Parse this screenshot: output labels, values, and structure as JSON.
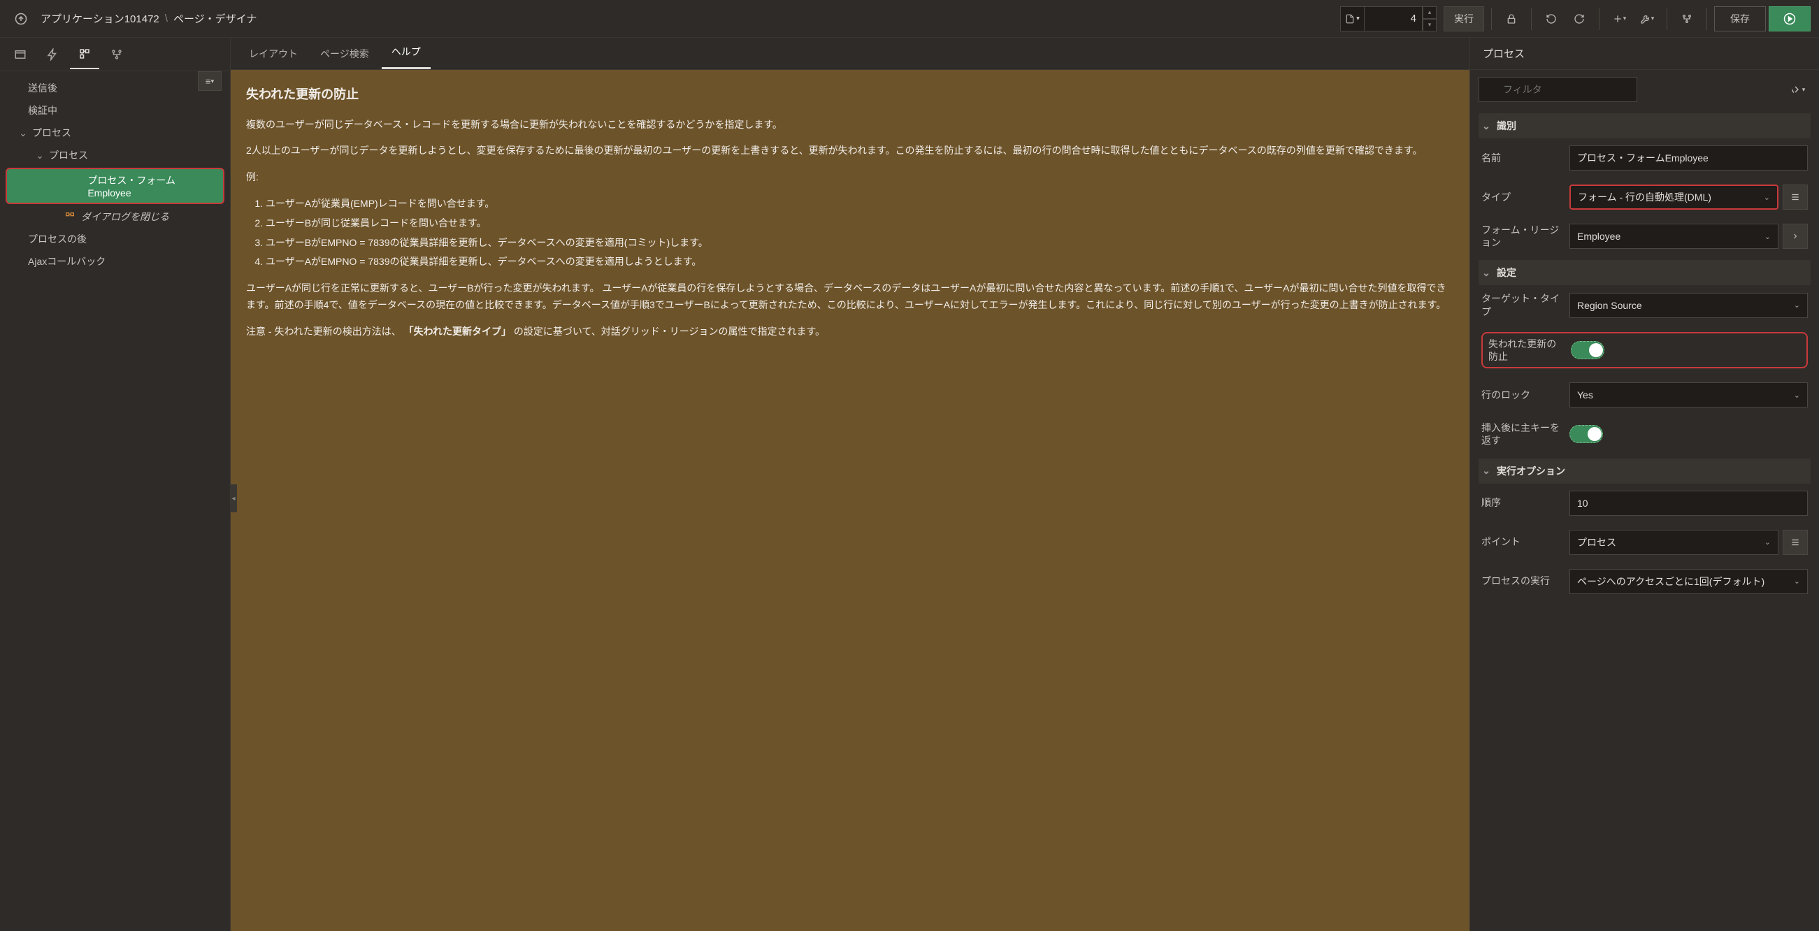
{
  "breadcrumb": {
    "app": "アプリケーション101472",
    "page": "ページ・デザイナ"
  },
  "topbar": {
    "page_number": "4",
    "go_label": "実行",
    "save_label": "保存"
  },
  "left_tree": {
    "items": {
      "after_submit": "送信後",
      "validating": "検証中",
      "processes": "プロセス",
      "processes_sub": "プロセス",
      "selected": "プロセス・フォームEmployee",
      "close_dialog": "ダイアログを閉じる",
      "after_processes": "プロセスの後",
      "ajax_callback": "Ajaxコールバック"
    }
  },
  "center": {
    "tabs": {
      "layout": "レイアウト",
      "page_search": "ページ検索",
      "help": "ヘルプ"
    },
    "help": {
      "title": "失われた更新の防止",
      "p1": "複数のユーザーが同じデータベース・レコードを更新する場合に更新が失われないことを確認するかどうかを指定します。",
      "p2": "2人以上のユーザーが同じデータを更新しようとし、変更を保存するために最後の更新が最初のユーザーの更新を上書きすると、更新が失われます。この発生を防止するには、最初の行の問合せ時に取得した値とともにデータベースの既存の列値を更新で確認できます。",
      "example_label": "例:",
      "ol": [
        "ユーザーAが従業員(EMP)レコードを問い合せます。",
        "ユーザーBが同じ従業員レコードを問い合せます。",
        "ユーザーBがEMPNO = 7839の従業員詳細を更新し、データベースへの変更を適用(コミット)します。",
        "ユーザーAがEMPNO = 7839の従業員詳細を更新し、データベースへの変更を適用しようとします。"
      ],
      "p3": "ユーザーAが同じ行を正常に更新すると、ユーザーBが行った変更が失われます。 ユーザーAが従業員の行を保存しようとする場合、データベースのデータはユーザーAが最初に問い合せた内容と異なっています。前述の手順1で、ユーザーAが最初に問い合せた列値を取得できます。前述の手順4で、値をデータベースの現在の値と比較できます。データベース値が手順3でユーザーBによって更新されたため、この比較により、ユーザーAに対してエラーが発生します。これにより、同じ行に対して別のユーザーが行った変更の上書きが防止されます。",
      "p4_a": "注意 - 失われた更新の検出方法は、",
      "p4_b": "「失われた更新タイプ」",
      "p4_c": "の設定に基づいて、対話グリッド・リージョンの属性で指定されます。"
    }
  },
  "right": {
    "header": "プロセス",
    "filter_placeholder": "フィルタ",
    "sections": {
      "identification": {
        "title": "識別",
        "name_label": "名前",
        "name_value": "プロセス・フォームEmployee",
        "type_label": "タイプ",
        "type_value": "フォーム - 行の自動処理(DML)",
        "form_region_label": "フォーム・リージョン",
        "form_region_value": "Employee"
      },
      "settings": {
        "title": "設定",
        "target_type_label": "ターゲット・タイプ",
        "target_type_value": "Region Source",
        "prevent_lost_label": "失われた更新の防止",
        "row_lock_label": "行のロック",
        "row_lock_value": "Yes",
        "return_pk_label": "挿入後に主キーを返す"
      },
      "exec": {
        "title": "実行オプション",
        "sequence_label": "順序",
        "sequence_value": "10",
        "point_label": "ポイント",
        "point_value": "プロセス",
        "run_label": "プロセスの実行",
        "run_value": "ページへのアクセスごとに1回(デフォルト)"
      }
    }
  }
}
